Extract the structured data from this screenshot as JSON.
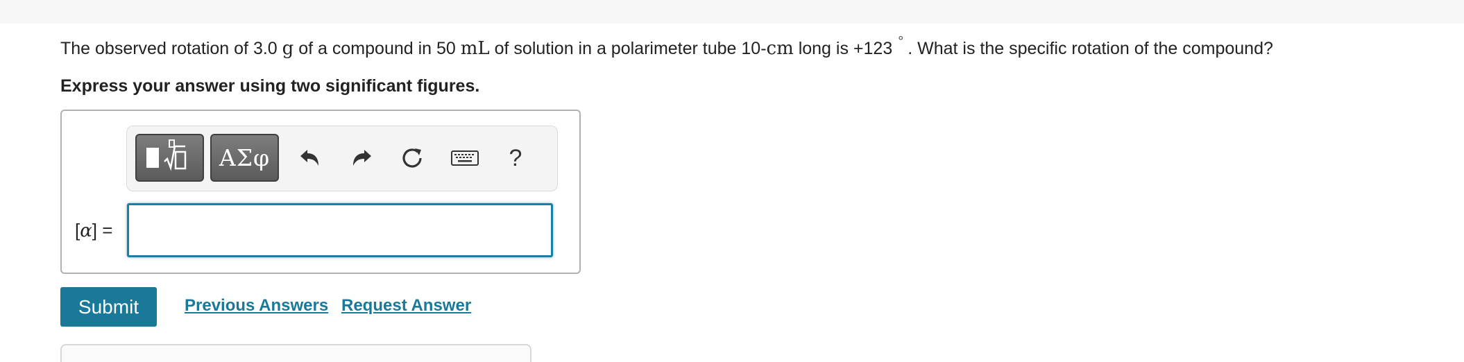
{
  "question": {
    "part1": "The observed rotation of 3.0 ",
    "unit_g": "g",
    "part2": " of a compound in 50 ",
    "unit_ml": "mL",
    "part3": " of solution in a polarimeter tube 10-",
    "unit_cm": "cm",
    "part4": " long is +123",
    "degree": "°",
    "part5": ". What is the specific rotation of the compound?"
  },
  "instruction": "Express your answer using two significant figures.",
  "toolbar": {
    "greek_label": "ΑΣφ",
    "help_label": "?",
    "icons": [
      "templates-icon",
      "greek-symbols-icon",
      "undo-icon",
      "redo-icon",
      "reset-icon",
      "keyboard-icon",
      "help-icon"
    ]
  },
  "answer": {
    "label_open": "[",
    "label_symbol": "α",
    "label_close": "] =",
    "value": ""
  },
  "actions": {
    "submit_label": "Submit",
    "previous_answers_label": "Previous Answers",
    "request_answer_label": "Request Answer"
  },
  "colors": {
    "accent": "#1a7899",
    "input_border": "#1d7ea3",
    "toolbar_button": "#5b5b5b"
  }
}
